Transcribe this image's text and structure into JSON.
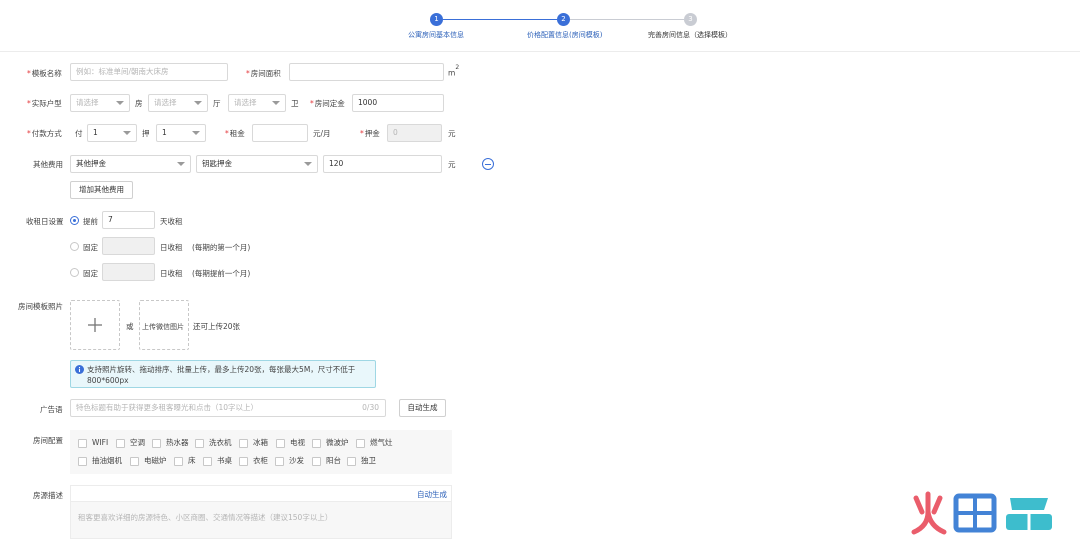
{
  "steps": [
    {
      "num": "1",
      "label": "公寓房间基本信息",
      "state": "active"
    },
    {
      "num": "2",
      "label": "价格配置信息(房间模板)",
      "state": "active"
    },
    {
      "num": "3",
      "label": "完善房间信息（选择模板）",
      "state": "todo"
    }
  ],
  "form": {
    "template_name_label": "模板名称",
    "template_name_placeholder": "例如：标准单间/朝南大床房",
    "room_area_label": "房间面积",
    "room_area_value": "",
    "room_area_unit": "m",
    "room_area_unit_sup": "2",
    "layout_label": "实际户型",
    "layout_select_placeholder": "请选择",
    "layout_unit_room": "房",
    "layout_unit_hall": "厅",
    "layout_unit_bath": "卫",
    "deposit_label": "房间定金",
    "deposit_value": "1000",
    "payment_label": "付款方式",
    "pay_prefix": "付",
    "pay_value": "1",
    "bet_prefix": "押",
    "bet_value": "1",
    "rent_label": "租金",
    "rent_value": "",
    "rent_unit": "元/月",
    "security_label": "押金",
    "security_value": "0",
    "security_unit": "元",
    "other_fees_label": "其他费用",
    "other_fee_type": "其他押金",
    "other_fee_name": "钥匙押金",
    "other_fee_amount": "120",
    "other_fee_unit": "元",
    "add_fee_button": "增加其他费用",
    "rent_day_label": "收租日设置",
    "option_advance": "提前",
    "advance_days": "7",
    "advance_suffix": "天收租",
    "option_fixed": "固定",
    "fixed_suffix": "日收租",
    "fixed_note_1": "(每期的第一个月)",
    "fixed_note_2": "(每期提前一个月)",
    "photos_label": "房间模板照片",
    "or_text": "或",
    "upload_wechat": "上传微信图片",
    "upload_remaining": "还可上传20张",
    "photo_tip": "支持照片旋转、拖动排序、批量上传，最多上传20张，每张最大5M，尺寸不低于800*600px",
    "ad_label": "广告语",
    "ad_placeholder": "特色标题有助于获得更多租客曝光和点击（10字以上）",
    "ad_counter": "0/30",
    "auto_generate_button": "自动生成",
    "amenities_label": "房间配置",
    "amenities": [
      "WIFI",
      "空调",
      "热水器",
      "洗衣机",
      "冰箱",
      "电视",
      "微波炉",
      "燃气灶",
      "抽油烟机",
      "电磁炉",
      "床",
      "书桌",
      "衣柜",
      "沙发",
      "阳台",
      "独卫"
    ],
    "description_label": "房源描述",
    "description_auto": "自动生成",
    "description_placeholder": "租客更喜欢详细的房源特色、小区商圈、交通情况等描述（建议150字以上）"
  },
  "colors": {
    "accent": "#3a6fd8",
    "required": "#e4393c",
    "tip_bg": "#e9f7fb"
  },
  "icons": {
    "plus": "plus-icon",
    "info": "info-icon",
    "remove": "minus-circle-icon"
  }
}
